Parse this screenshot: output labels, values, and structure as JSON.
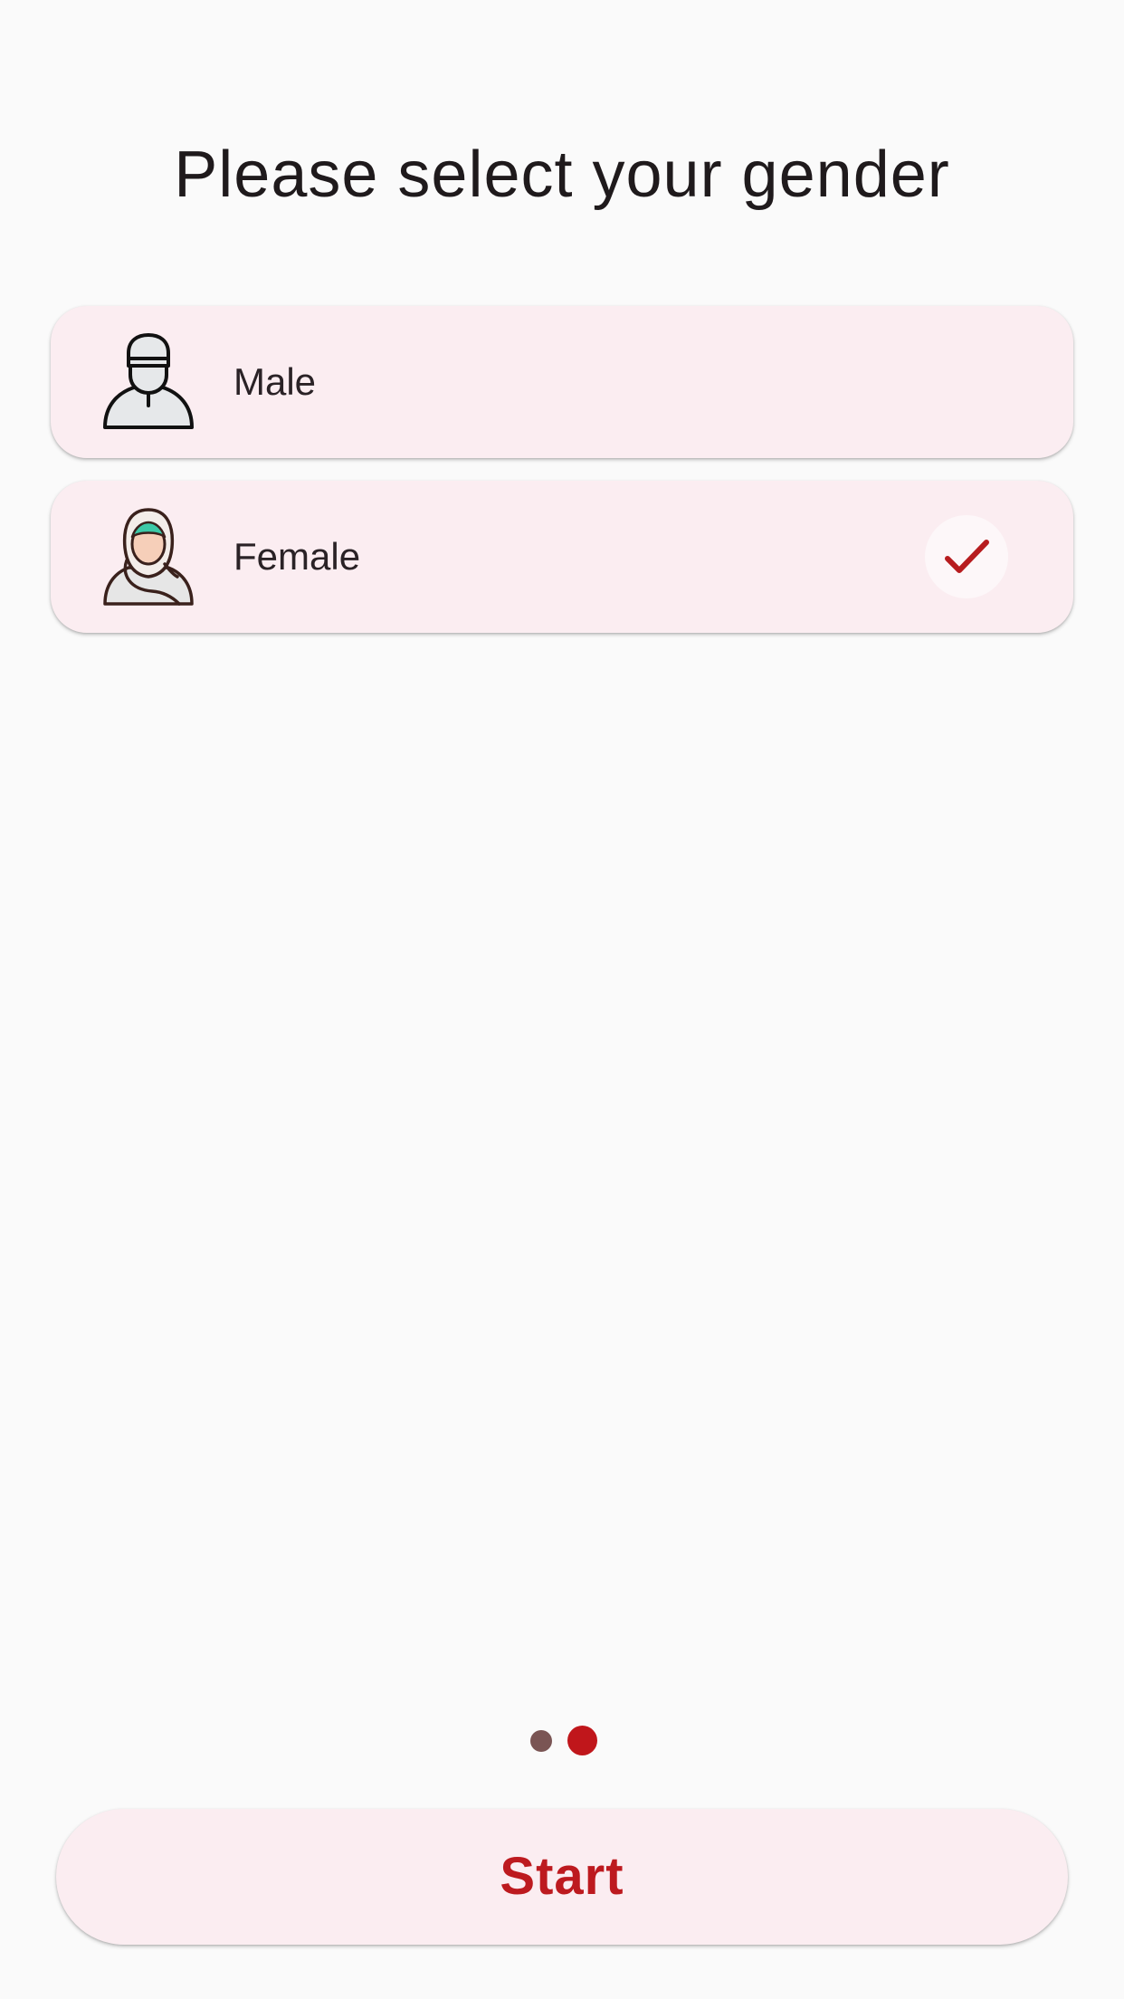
{
  "header": {
    "title": "Please select your gender"
  },
  "options": [
    {
      "label": "Male",
      "icon": "male-avatar-icon",
      "selected": false
    },
    {
      "label": "Female",
      "icon": "female-hijab-avatar-icon",
      "selected": true
    }
  ],
  "pager": {
    "total_pages": 2,
    "current_page": 2
  },
  "footer": {
    "start_label": "Start"
  },
  "colors": {
    "background": "#fafafa",
    "card": "#fbedf1",
    "accent": "#bd1a1f",
    "dot_inactive": "#7a5554",
    "dot_active": "#c0161b",
    "text": "#1f1a1c"
  }
}
